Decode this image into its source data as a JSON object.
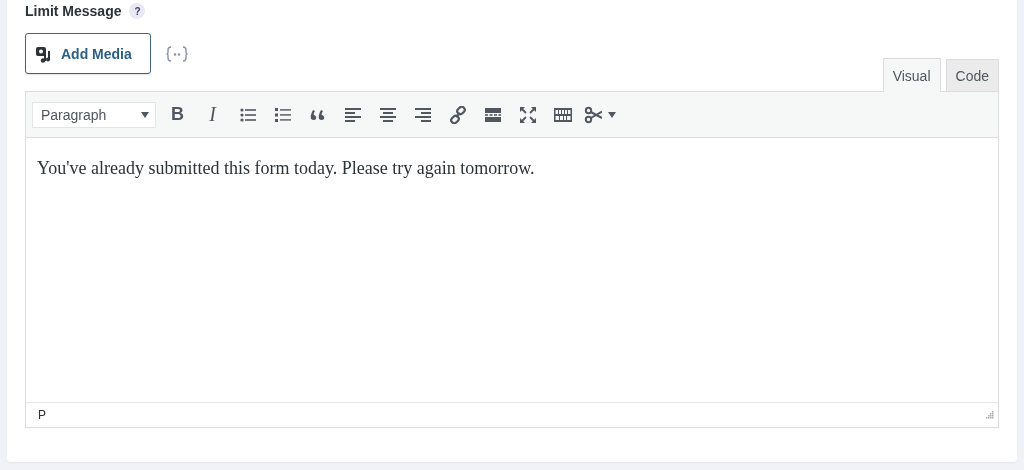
{
  "field": {
    "label": "Limit Message",
    "help": "?"
  },
  "add_media": {
    "label": "Add Media"
  },
  "tabs": [
    {
      "label": "Visual",
      "selected": true
    },
    {
      "label": "Code",
      "selected": false
    }
  ],
  "format_select": {
    "value": "Paragraph"
  },
  "toolbar": [
    {
      "kind": "bold",
      "label": "B"
    },
    {
      "kind": "italic",
      "label": "I"
    },
    {
      "kind": "bullet-list"
    },
    {
      "kind": "numbered-list"
    },
    {
      "kind": "quote"
    },
    {
      "kind": "align-left"
    },
    {
      "kind": "align-center"
    },
    {
      "kind": "align-right"
    },
    {
      "kind": "link"
    },
    {
      "kind": "read-more"
    },
    {
      "kind": "fullscreen"
    },
    {
      "kind": "keyboard"
    },
    {
      "kind": "scissors"
    }
  ],
  "content": "You've already submitted this form today. Please try again tomorrow.",
  "status_path": "P"
}
